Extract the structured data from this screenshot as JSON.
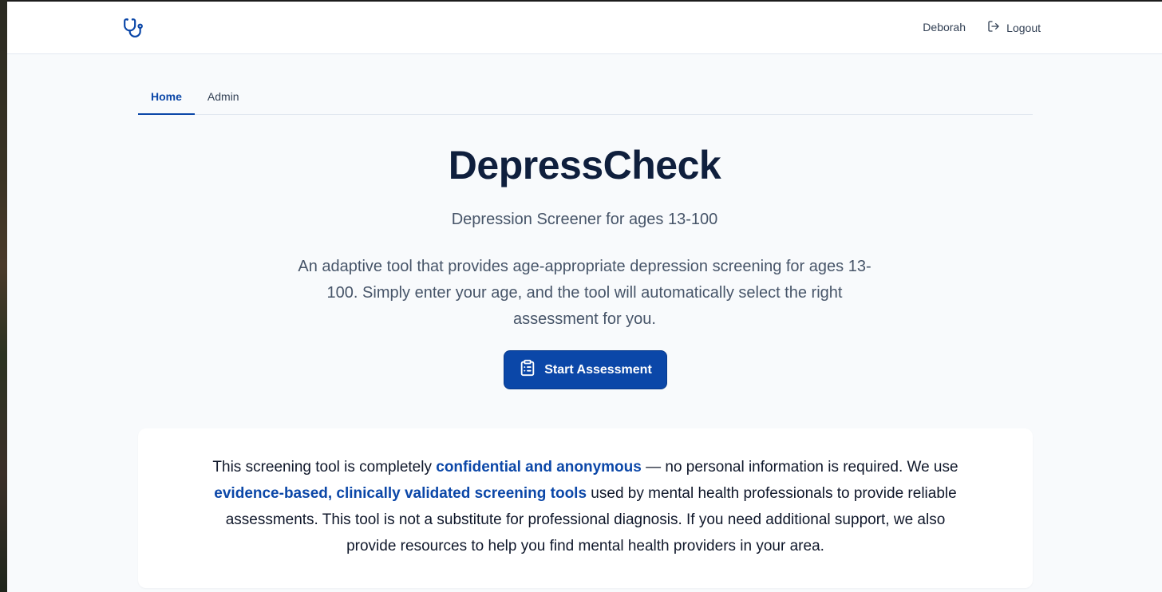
{
  "navbar": {
    "logo_icon": "stethoscope-icon",
    "user_name": "Deborah",
    "logout_label": "Logout",
    "logout_icon": "logout-icon"
  },
  "tabs": [
    {
      "label": "Home",
      "active": true
    },
    {
      "label": "Admin",
      "active": false
    }
  ],
  "hero": {
    "title": "DepressCheck",
    "subtitle": "Depression Screener for ages 13-100",
    "description": "An adaptive tool that provides age-appropriate depression screening for ages 13-100. Simply enter your age, and the tool will automatically select the right assessment for you.",
    "cta_label": "Start Assessment",
    "cta_icon": "clipboard-list-icon"
  },
  "info": {
    "part1": "This screening tool is completely ",
    "highlight1": "confidential and anonymous",
    "part2": " — no personal information is required. We use ",
    "highlight2": "evidence-based, clinically validated screening tools",
    "part3": " used by mental health professionals to provide reliable assessments. This tool is not a substitute for professional diagnosis. If you need additional support, we also provide resources to help you find mental health providers in your area."
  },
  "colors": {
    "primary": "#0b47a8",
    "title": "#0f1f3d",
    "muted_text": "#475569",
    "background": "#f8fafc"
  }
}
